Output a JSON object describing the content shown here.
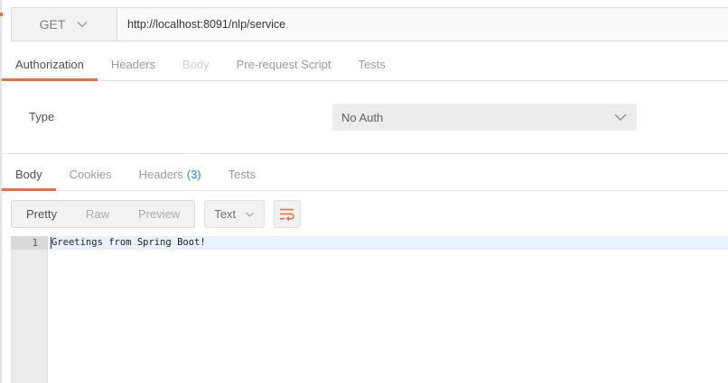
{
  "request": {
    "method": "GET",
    "url": "http://localhost:8091/nlp/service"
  },
  "request_tabs": [
    {
      "label": "Authorization",
      "state": "active"
    },
    {
      "label": "Headers",
      "state": "normal"
    },
    {
      "label": "Body",
      "state": "disabled"
    },
    {
      "label": "Pre-request Script",
      "state": "normal"
    },
    {
      "label": "Tests",
      "state": "normal"
    }
  ],
  "auth": {
    "type_label": "Type",
    "selected": "No Auth"
  },
  "response_tabs": [
    {
      "label": "Body",
      "state": "active"
    },
    {
      "label": "Cookies",
      "state": "normal"
    },
    {
      "label": "Headers",
      "count": "(3)",
      "state": "normal"
    },
    {
      "label": "Tests",
      "state": "normal"
    }
  ],
  "view_modes": [
    {
      "label": "Pretty",
      "state": "active"
    },
    {
      "label": "Raw",
      "state": "normal"
    },
    {
      "label": "Preview",
      "state": "normal"
    }
  ],
  "format": {
    "selected": "Text"
  },
  "icons": {
    "method_dropdown": "chevron-down-icon",
    "auth_dropdown": "chevron-down-icon",
    "format_dropdown": "chevron-down-icon",
    "wrap": "wrap-lines-icon"
  },
  "colors": {
    "accent": "#f26b3a",
    "count": "#2a8bd4",
    "active_line": "#e8f2ff"
  },
  "editor": {
    "lines": [
      {
        "number": "1",
        "text": "Greetings from Spring Boot!"
      }
    ]
  }
}
